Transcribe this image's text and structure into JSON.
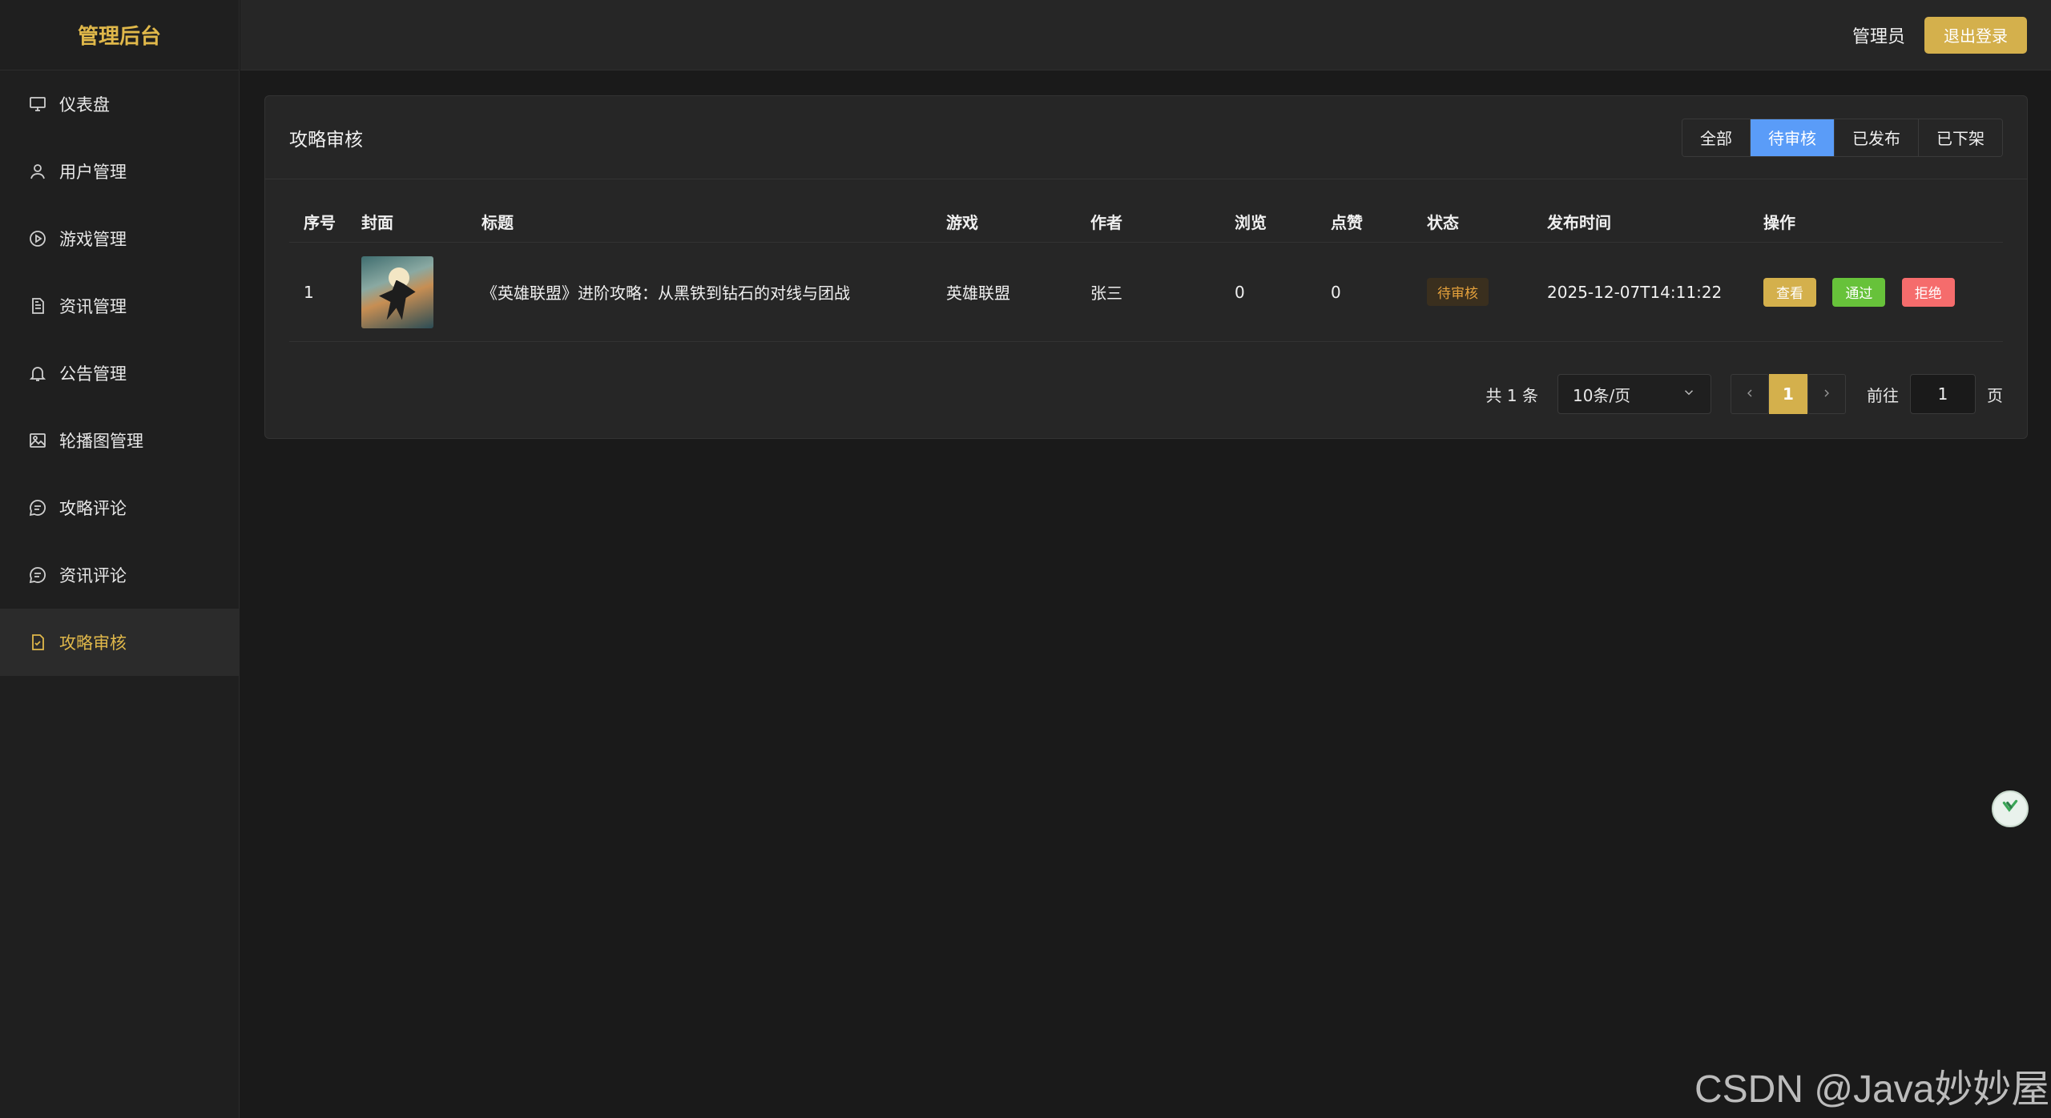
{
  "brand": "管理后台",
  "sidebar": {
    "items": [
      {
        "label": "仪表盘",
        "icon": "monitor-icon"
      },
      {
        "label": "用户管理",
        "icon": "user-icon"
      },
      {
        "label": "游戏管理",
        "icon": "play-circle-icon"
      },
      {
        "label": "资讯管理",
        "icon": "document-icon"
      },
      {
        "label": "公告管理",
        "icon": "bell-icon"
      },
      {
        "label": "轮播图管理",
        "icon": "picture-icon"
      },
      {
        "label": "攻略评论",
        "icon": "chat-icon"
      },
      {
        "label": "资讯评论",
        "icon": "chat-icon"
      },
      {
        "label": "攻略审核",
        "icon": "document-checked-icon",
        "active": true
      }
    ]
  },
  "header": {
    "user": "管理员",
    "logout_label": "退出登录"
  },
  "card": {
    "title": "攻略审核",
    "tabs": [
      {
        "label": "全部"
      },
      {
        "label": "待审核",
        "active": true
      },
      {
        "label": "已发布"
      },
      {
        "label": "已下架"
      }
    ]
  },
  "table": {
    "columns": [
      "序号",
      "封面",
      "标题",
      "游戏",
      "作者",
      "浏览",
      "点赞",
      "状态",
      "发布时间",
      "操作"
    ],
    "rows": [
      {
        "index": "1",
        "title": "《英雄联盟》进阶攻略：从黑铁到钻石的对线与团战",
        "game": "英雄联盟",
        "author": "张三",
        "views": "0",
        "likes": "0",
        "status": "待审核",
        "published": "2025-12-07T14:11:22",
        "actions": {
          "view": "查看",
          "pass": "通过",
          "reject": "拒绝"
        }
      }
    ]
  },
  "pagination": {
    "total_text": "共 1 条",
    "page_size": "10条/页",
    "current_page": "1",
    "goto_label": "前往",
    "goto_value": "1",
    "page_suffix": "页"
  },
  "watermark": "CSDN @Java妙妙屋",
  "colors": {
    "accent": "#d4b04c",
    "tab_active": "#5a9cf8",
    "pass": "#67c23a",
    "reject": "#f56c6c",
    "pending": "#e6a23c"
  }
}
